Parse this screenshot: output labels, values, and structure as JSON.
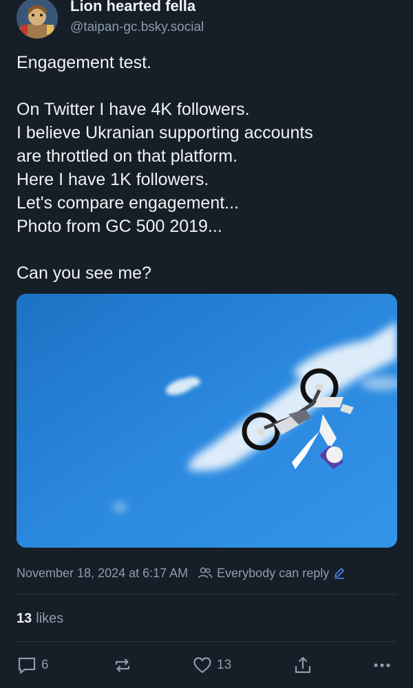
{
  "author": {
    "display_name": "Lion hearted fella",
    "handle": "@taipan-gc.bsky.social",
    "avatar_icon": "avatar-image"
  },
  "post": {
    "lines": [
      "Engagement test.",
      "",
      "On Twitter I have 4K followers.",
      "I believe Ukranian supporting accounts",
      "are throttled on that platform.",
      "Here I have 1K followers.",
      "Let's compare engagement...",
      "Photo from GC 500 2019...",
      "",
      "Can you see me?"
    ],
    "image": "motocross-rider-backflip-photo"
  },
  "meta": {
    "timestamp": "November 18, 2024 at 6:17 AM",
    "reply_setting": "Everybody can reply",
    "people_icon": "people-icon",
    "edit_icon": "pencil-icon"
  },
  "stats": {
    "likes_count": "13",
    "likes_label": "likes"
  },
  "actions": {
    "reply_count": "6",
    "like_count": "13",
    "reply_icon": "comment-icon",
    "repost_icon": "repost-icon",
    "like_icon": "heart-icon",
    "share_icon": "share-icon",
    "more_icon": "more-dots-icon"
  },
  "colors": {
    "background": "#161e27",
    "text": "#f1f3f5",
    "muted": "#8d9cb0",
    "link": "#4a86f5",
    "sky": "#2a8ae0"
  }
}
